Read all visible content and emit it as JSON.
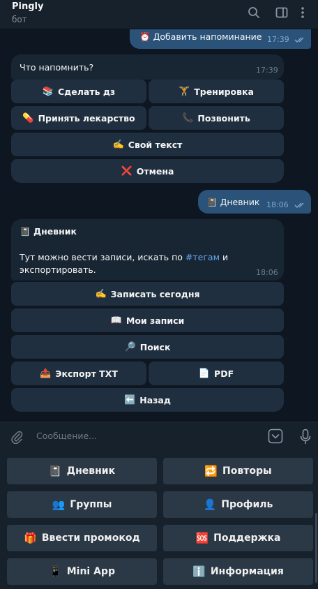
{
  "header": {
    "title": "Pingly",
    "subtitle": "бот",
    "icons": [
      "search-icon",
      "sidebar-toggle-icon",
      "more-vertical-icon"
    ]
  },
  "messages": {
    "m1": {
      "emoji": "⏰",
      "text": "Добавить напоминание",
      "time": "17:39"
    },
    "m2": {
      "text": "Что напомнить?",
      "time": "17:39",
      "buttons": [
        {
          "emoji": "📚",
          "label": "Сделать дз"
        },
        {
          "emoji": "🏋",
          "label": "Тренировка"
        },
        {
          "emoji": "💊",
          "label": "Принять лекарство"
        },
        {
          "emoji": "📞",
          "label": "Позвонить"
        },
        {
          "emoji": "✍️",
          "label": "Свой текст"
        },
        {
          "emoji": "❌",
          "label": "Отмена"
        }
      ]
    },
    "m3": {
      "emoji": "📓",
      "text": "Дневник",
      "time": "18:06"
    },
    "m4": {
      "title_emoji": "📓",
      "title": "Дневник",
      "body_pre": "Тут можно вести записи, искать по ",
      "body_link": "#тегам",
      "body_post": " и экспортировать.",
      "time": "18:06",
      "buttons": [
        {
          "emoji": "✍️",
          "label": "Записать сегодня"
        },
        {
          "emoji": "📖",
          "label": "Мои записи"
        },
        {
          "emoji": "🔎",
          "label": "Поиск"
        },
        {
          "emoji": "📤",
          "label": "Экспорт TXT"
        },
        {
          "emoji": "📄",
          "label": "PDF"
        },
        {
          "emoji": "⬅️",
          "label": "Назад"
        }
      ]
    }
  },
  "input": {
    "placeholder": "Сообщение..."
  },
  "keyboard": [
    {
      "emoji": "📓",
      "label": "Дневник"
    },
    {
      "emoji": "🔁",
      "label": "Повторы"
    },
    {
      "emoji": "👥",
      "label": "Группы"
    },
    {
      "emoji": "👤",
      "label": "Профиль"
    },
    {
      "emoji": "🎁",
      "label": "Ввести промокод"
    },
    {
      "emoji": "🆘",
      "label": "Поддержка"
    },
    {
      "emoji": "📱",
      "label": "Mini App"
    },
    {
      "emoji": "ℹ️",
      "label": "Информация"
    }
  ],
  "colors": {
    "background": "#0e1621",
    "header": "#17212b",
    "outgoing_bubble": "#2b5278",
    "incoming_bubble": "#182533",
    "inline_button": "#1f2f3f",
    "reply_key": "#2b3845",
    "link": "#62a8ea"
  }
}
